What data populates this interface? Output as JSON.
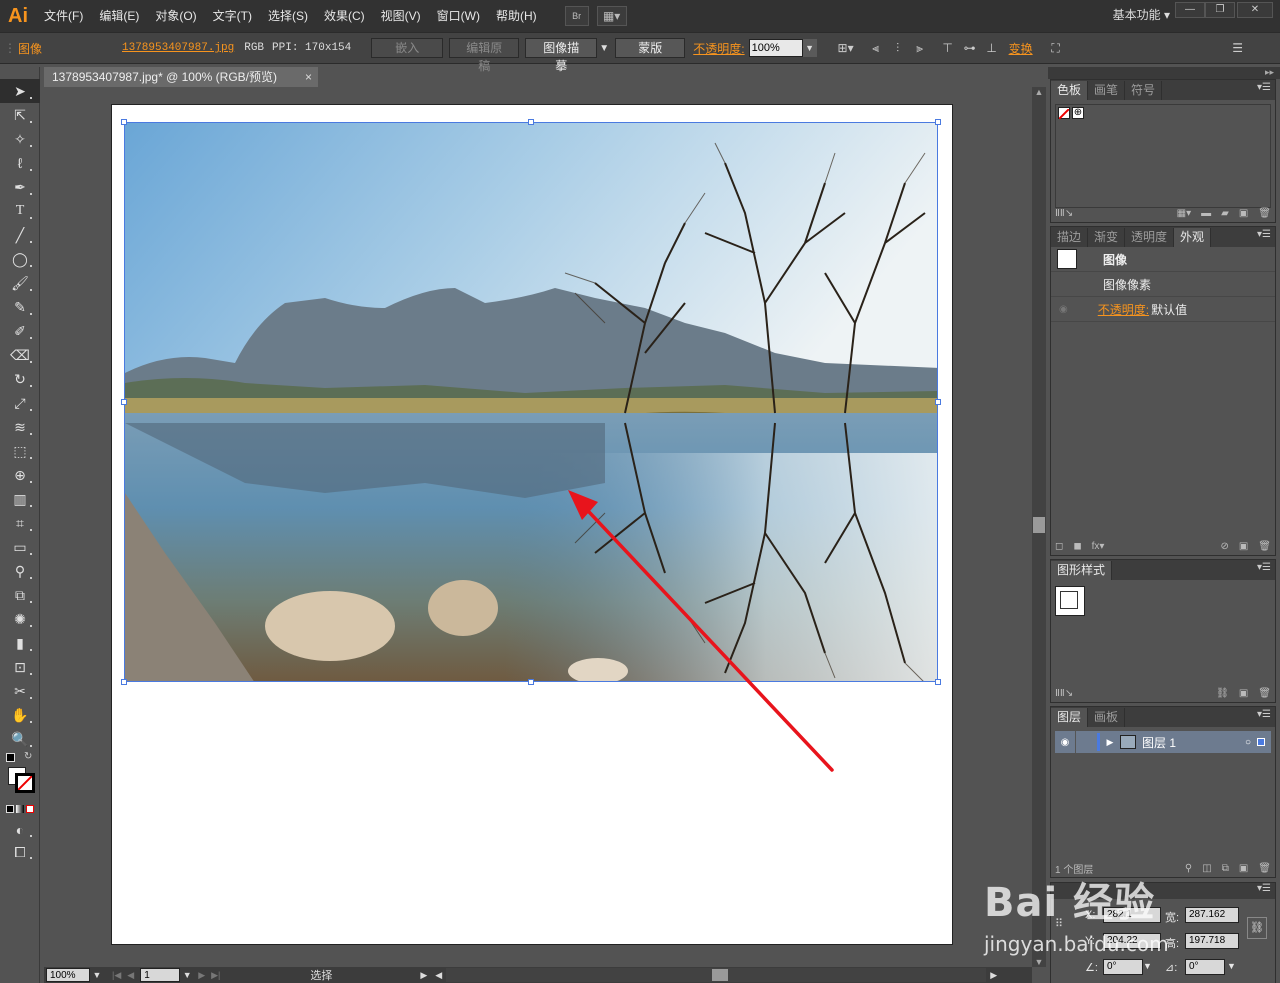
{
  "app": {
    "logo": "Ai"
  },
  "menu": {
    "items": [
      "文件(F)",
      "编辑(E)",
      "对象(O)",
      "文字(T)",
      "选择(S)",
      "效果(C)",
      "视图(V)",
      "窗口(W)",
      "帮助(H)"
    ],
    "bridge_label": "Br",
    "workspace": "基本功能"
  },
  "control_bar": {
    "object_type": "图像",
    "file_name": "1378953407987.jpg",
    "color_mode": "RGB",
    "ppi": "PPI: 170x154",
    "embed": "嵌入",
    "edit_original": "编辑原稿",
    "image_trace": "图像描摹",
    "mask": "蒙版",
    "opacity_label": "不透明度:",
    "opacity_value": "100%",
    "transform": "变换"
  },
  "document": {
    "tab_title": "1378953407987.jpg* @ 100% (RGB/预览)",
    "close": "×"
  },
  "status_bar": {
    "zoom": "100%",
    "artboard": "1",
    "tool": "选择"
  },
  "panels": {
    "swatches": {
      "tabs": [
        "色板",
        "画笔",
        "符号"
      ]
    },
    "appearance": {
      "tabs": [
        "描边",
        "渐变",
        "透明度",
        "外观"
      ],
      "title": "图像",
      "row1": "图像像素",
      "opacity_label": "不透明度:",
      "opacity_value": "默认值"
    },
    "graphic_styles": {
      "tabs": [
        "图形样式"
      ]
    },
    "layers": {
      "tabs": [
        "图层",
        "画板"
      ],
      "layer_name": "图层 1",
      "count": "1 个图层"
    },
    "transform": {
      "x_label": "X:",
      "x_value": "282.1",
      "w_label": "宽:",
      "w_value": "287.162",
      "y_label": "Y:",
      "y_value": "204.22",
      "h_label": "高:",
      "h_value": "197.718",
      "rotate_value": "0°",
      "shear_value": "0°"
    }
  },
  "watermark": {
    "brand": "Bai 经验",
    "url": "jingyan.baidu.com"
  },
  "colors": {
    "accent": "#f7941e",
    "selection": "#4a7ae0",
    "arrow": "#e8141c"
  }
}
